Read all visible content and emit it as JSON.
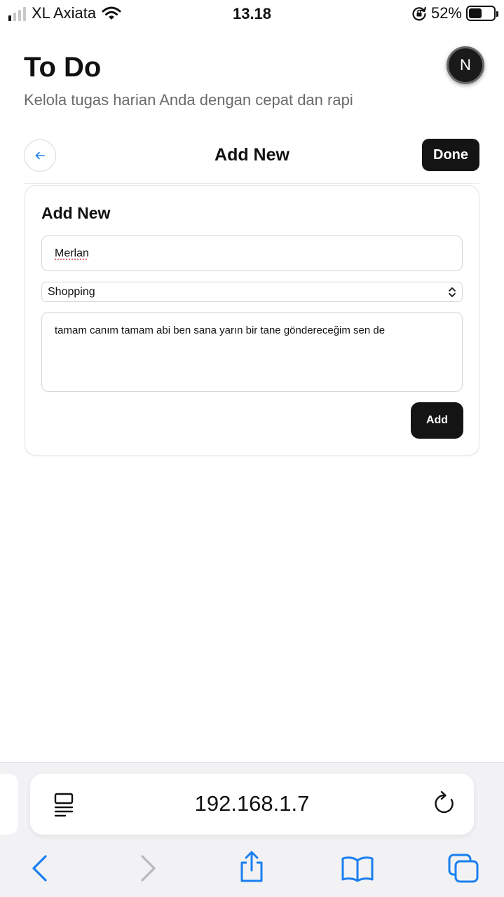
{
  "status_bar": {
    "carrier": "XL Axiata",
    "time": "13.18",
    "battery_percent": "52%",
    "battery_level": 0.52,
    "signal_bars_filled": 1,
    "icons": [
      "signal-icon",
      "wifi-icon",
      "orientation-lock-icon",
      "battery-icon"
    ]
  },
  "header": {
    "title": "To Do",
    "subtitle": "Kelola tugas harian Anda dengan cepat dan rapi",
    "avatar_initial": "N"
  },
  "nav": {
    "title": "Add New",
    "done_label": "Done",
    "back_icon": "arrow-left-icon"
  },
  "form": {
    "title": "Add New",
    "name_value": "Merlan",
    "category_value": "Shopping",
    "notes_value": "tamam canım tamam abi ben sana yarın bir tane göndereceğim sen de",
    "add_label": "Add"
  },
  "browser": {
    "url": "192.168.1.7",
    "icons": [
      "page-menu-icon",
      "reload-icon",
      "back-icon",
      "forward-icon",
      "share-icon",
      "bookmarks-icon",
      "tabs-icon"
    ]
  },
  "colors": {
    "accent": "#1a7ff0",
    "primary_button": "#141414",
    "subtitle_text": "#6b6b6b",
    "browser_bar": "#f2f2f4",
    "disabled_icon": "#b8b8be"
  }
}
